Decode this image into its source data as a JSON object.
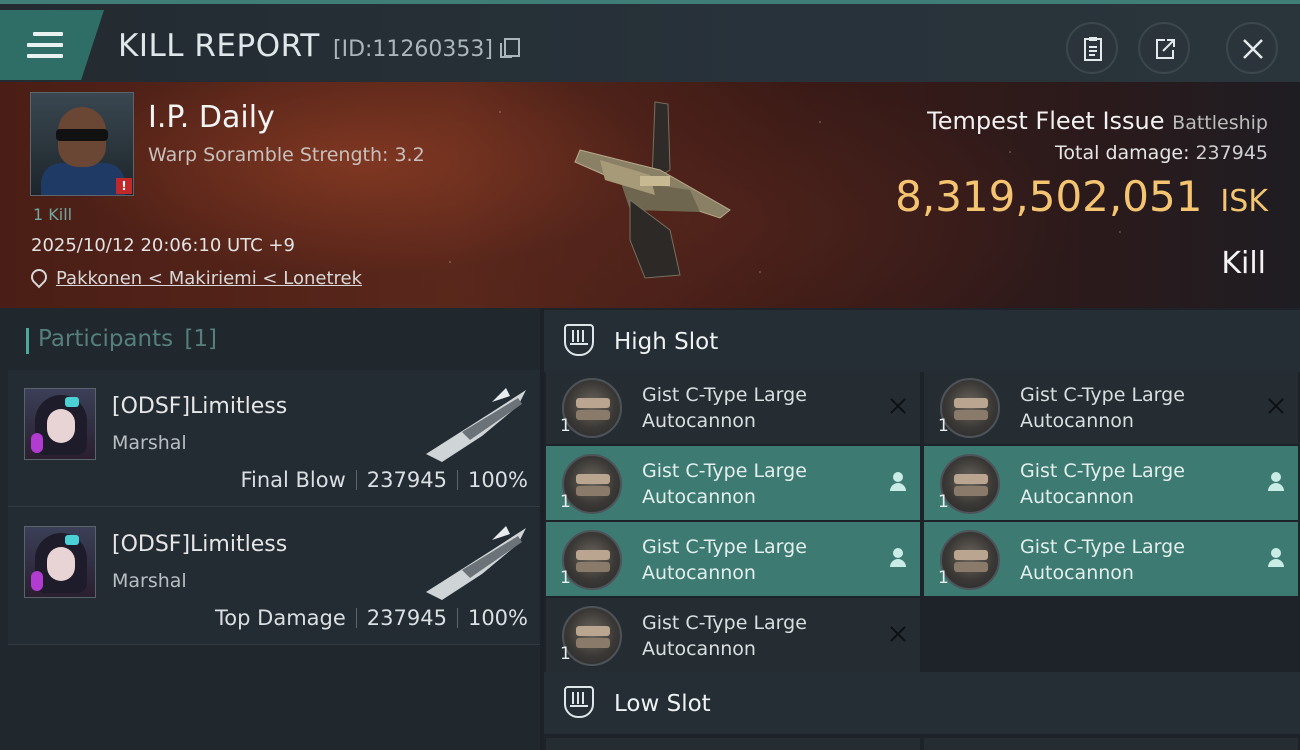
{
  "header": {
    "title": "KILL REPORT",
    "report_id": "[ID:11260353]"
  },
  "victim": {
    "pilot_name": "I.P. Daily",
    "warp_scramble": "Warp Soramble Strength: 3.2",
    "kill_tag": "1 Kill",
    "datetime": "2025/10/12 20:06:10 UTC +9",
    "location": "Pakkonen < Makiriemi < Lonetrek",
    "ship_name": "Tempest Fleet Issue",
    "ship_class": "Battleship",
    "total_damage_label": "Total damage:",
    "total_damage": "237945",
    "isk_value": "8,319,502,051",
    "isk_unit": "ISK",
    "result": "Kill"
  },
  "participants": {
    "label": "Participants",
    "count": "[1]",
    "items": [
      {
        "name": "[ODSF]Limitless",
        "rank": "Marshal",
        "role": "Final Blow",
        "damage": "237945",
        "percent": "100%"
      },
      {
        "name": "[ODSF]Limitless",
        "rank": "Marshal",
        "role": "Top Damage",
        "damage": "237945",
        "percent": "100%"
      }
    ]
  },
  "fitting": {
    "high_slot_label": "High Slot",
    "low_slot_label": "Low Slot",
    "high_slot_modules": [
      {
        "name": "Gist C-Type Large Autocannon",
        "qty": "1",
        "state": "destroyed",
        "status_icon": "x-icon"
      },
      {
        "name": "Gist C-Type Large Autocannon",
        "qty": "1",
        "state": "destroyed",
        "status_icon": "x-icon"
      },
      {
        "name": "Gist C-Type Large Autocannon",
        "qty": "1",
        "state": "dropped",
        "status_icon": "pilot-icon"
      },
      {
        "name": "Gist C-Type Large Autocannon",
        "qty": "1",
        "state": "dropped",
        "status_icon": "pilot-icon"
      },
      {
        "name": "Gist C-Type Large Autocannon",
        "qty": "1",
        "state": "dropped",
        "status_icon": "pilot-icon"
      },
      {
        "name": "Gist C-Type Large Autocannon",
        "qty": "1",
        "state": "dropped",
        "status_icon": "pilot-icon"
      },
      {
        "name": "Gist C-Type Large Autocannon",
        "qty": "1",
        "state": "destroyed",
        "status_icon": "x-icon"
      }
    ]
  },
  "colors": {
    "accent_teal": "#3d7a72",
    "isk_gold": "#f4c471",
    "alert_red": "#c0282a"
  }
}
